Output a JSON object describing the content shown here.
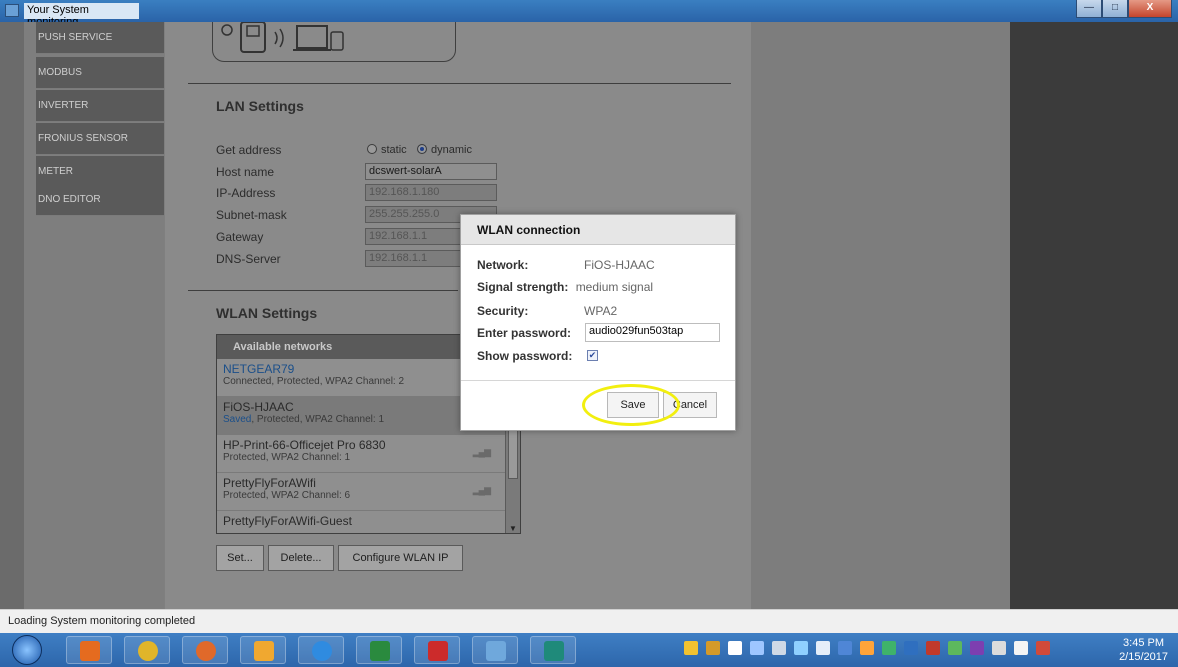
{
  "window": {
    "title": "Your System monitoring",
    "min_btn": "—",
    "max_btn": "□",
    "close_btn": "X"
  },
  "nav": {
    "items": [
      "PUSH SERVICE",
      "MODBUS",
      "INVERTER",
      "FRONIUS SENSOR CARDS",
      "METER",
      "DNO EDITOR"
    ]
  },
  "lan": {
    "heading": "LAN Settings",
    "get_address_label": "Get address",
    "radio_static": "static",
    "radio_dynamic": "dynamic",
    "selected_mode": "dynamic",
    "host_name_label": "Host name",
    "host_name_value": "dcswert-solarA",
    "ip_label": "IP-Address",
    "ip_value": "192.168.1.180",
    "subnet_label": "Subnet-mask",
    "subnet_value": "255.255.255.0",
    "gateway_label": "Gateway",
    "gateway_value": "192.168.1.1",
    "dns_label": "DNS-Server",
    "dns_value": "192.168.1.1"
  },
  "wlan": {
    "heading": "WLAN Settings",
    "list_header": "Available networks",
    "networks": [
      {
        "name": "NETGEAR79",
        "detail": "Connected, Protected, WPA2 Channel: 2"
      },
      {
        "name": "FiOS-HJAAC",
        "detail_saved": "Saved",
        "detail": ", Protected, WPA2 Channel: 1"
      },
      {
        "name": "HP-Print-66-Officejet Pro 6830",
        "detail": "Protected, WPA2 Channel: 1"
      },
      {
        "name": "PrettyFlyForAWifi",
        "detail": "Protected, WPA2 Channel: 6"
      },
      {
        "name": "PrettyFlyForAWifi-Guest",
        "detail": ""
      }
    ],
    "buttons": {
      "set": "Set...",
      "delete": "Delete...",
      "configure": "Configure WLAN IP"
    }
  },
  "dialog": {
    "title": "WLAN connection",
    "network_label": "Network:",
    "network_value": "FiOS-HJAAC",
    "signal_label": "Signal strength:",
    "signal_value": "medium signal",
    "security_label": "Security:",
    "security_value": "WPA2",
    "password_label": "Enter password:",
    "password_value": "audio029fun503tap",
    "show_password_label": "Show password:",
    "show_password_checked": true,
    "save_label": "Save",
    "cancel_label": "Cancel",
    "highlight_color": "#f2ef0f"
  },
  "status": {
    "text": "Loading System monitoring completed"
  },
  "taskbar": {
    "apps": [
      "outlook-icon",
      "chrome-icon",
      "firefox-icon",
      "outlook-alt-icon",
      "ie-icon",
      "excel-icon",
      "pdf-icon",
      "monitor-app-icon",
      "publisher-icon"
    ],
    "time": "3:45 PM",
    "date": "2/15/2017"
  }
}
